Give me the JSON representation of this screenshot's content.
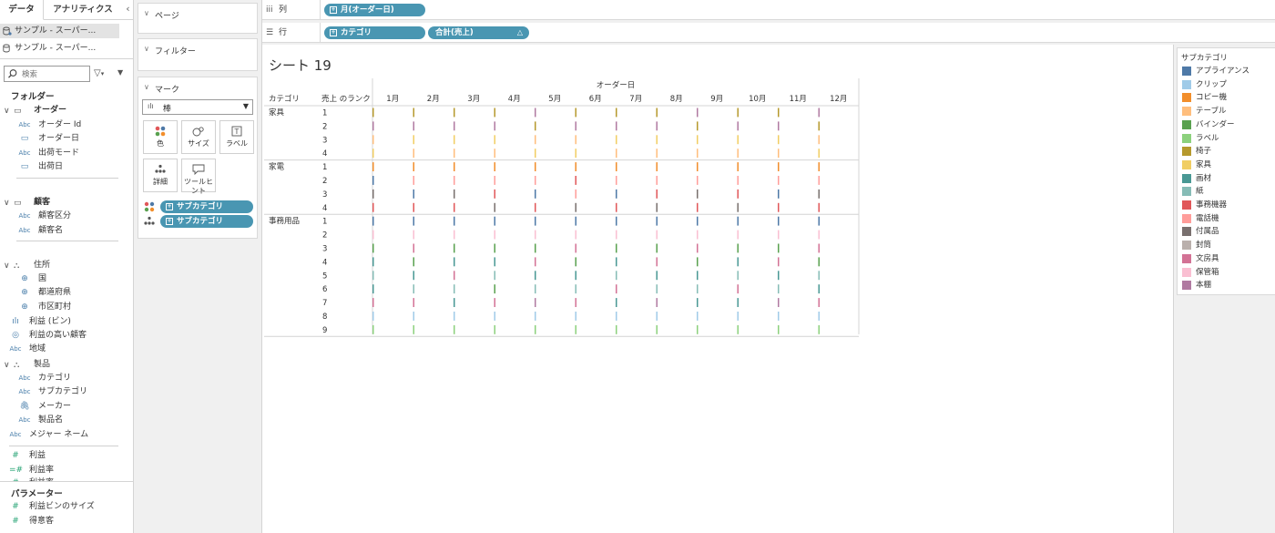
{
  "data_pane": {
    "tabs": [
      "データ",
      "アナリティクス"
    ],
    "collapse_glyph": "‹",
    "data_sources": [
      "サンプル - スーパー...",
      "サンプル - スーパー..."
    ],
    "search_placeholder": "検索",
    "folders_title": "フォルダー",
    "parameters_title": "パラメーター",
    "groups": [
      {
        "name": "オーダー",
        "bold": true,
        "fields": [
          {
            "label": "オーダー Id",
            "type": "Abc"
          },
          {
            "label": "オーダー日",
            "type": "date"
          },
          {
            "label": "出荷モード",
            "type": "Abc"
          },
          {
            "label": "出荷日",
            "type": "date"
          }
        ]
      },
      {
        "name": "顧客",
        "bold": true,
        "fields": [
          {
            "label": "顧客区分",
            "type": "Abc"
          },
          {
            "label": "顧客名",
            "type": "Abc"
          }
        ]
      },
      {
        "name": "住所",
        "bold": false,
        "fields": [
          {
            "label": "国",
            "type": "geo"
          },
          {
            "label": "都道府県",
            "type": "geo"
          },
          {
            "label": "市区町村",
            "type": "geo"
          }
        ]
      }
    ],
    "loose_fields": [
      {
        "label": "利益 (ビン)",
        "type": "bin"
      },
      {
        "label": "利益の高い顧客",
        "type": "set"
      },
      {
        "label": "地域",
        "type": "Abc"
      }
    ],
    "product_group": {
      "name": "製品",
      "fields": [
        {
          "label": "カテゴリ",
          "type": "Abc"
        },
        {
          "label": "サブカテゴリ",
          "type": "Abc"
        },
        {
          "label": "メーカー",
          "type": "clip"
        },
        {
          "label": "製品名",
          "type": "Abc"
        }
      ]
    },
    "after_product": [
      {
        "label": "メジャー ネーム",
        "type": "Abc"
      }
    ],
    "measures": [
      {
        "label": "利益",
        "type": "meas"
      },
      {
        "label": "利益率",
        "type": "meas-calc"
      },
      {
        "label": "利益率",
        "type": "meas"
      }
    ],
    "parameters": [
      {
        "label": "利益ビンのサイズ",
        "type": "meas"
      },
      {
        "label": "得意客",
        "type": "meas"
      }
    ]
  },
  "cards": {
    "pages_title": "ページ",
    "filters_title": "フィルター",
    "marks_title": "マーク",
    "mark_type": "棒",
    "mark_buttons": [
      "色",
      "サイズ",
      "ラベル",
      "詳細",
      "ツールヒント"
    ],
    "mark_pills": [
      "サブカテゴリ",
      "サブカテゴリ"
    ]
  },
  "shelves": {
    "columns_label": "列",
    "rows_label": "行",
    "column_pills": [
      "月(オーダー日)"
    ],
    "row_pills": [
      "カテゴリ",
      "合計(売上)"
    ]
  },
  "sheet": {
    "title": "シート 19"
  },
  "legend": {
    "title": "サブカテゴリ",
    "items": [
      {
        "label": "アプライアンス",
        "color": "#4e79a7"
      },
      {
        "label": "クリップ",
        "color": "#a0cbe8"
      },
      {
        "label": "コピー機",
        "color": "#f28e2b"
      },
      {
        "label": "テーブル",
        "color": "#ffbe7d"
      },
      {
        "label": "バインダー",
        "color": "#59a14f"
      },
      {
        "label": "ラベル",
        "color": "#8cd17d"
      },
      {
        "label": "椅子",
        "color": "#b6992d"
      },
      {
        "label": "家具",
        "color": "#f1ce63"
      },
      {
        "label": "画材",
        "color": "#499894"
      },
      {
        "label": "紙",
        "color": "#86bcb6"
      },
      {
        "label": "事務機器",
        "color": "#e15759"
      },
      {
        "label": "電話機",
        "color": "#ff9d9a"
      },
      {
        "label": "付属品",
        "color": "#79706e"
      },
      {
        "label": "封筒",
        "color": "#bab0ac"
      },
      {
        "label": "文房具",
        "color": "#d37295"
      },
      {
        "label": "保管箱",
        "color": "#fabfd2"
      },
      {
        "label": "本棚",
        "color": "#b07aa1"
      }
    ]
  },
  "chart_data": {
    "type": "table",
    "column_header_title": "オーダー日",
    "row_header_titles": [
      "カテゴリ",
      "売上 のランク"
    ],
    "columns": [
      "1月",
      "2月",
      "3月",
      "4月",
      "5月",
      "6月",
      "7月",
      "8月",
      "9月",
      "10月",
      "11月",
      "12月"
    ],
    "categories": [
      {
        "name": "家具",
        "ranks": [
          "1",
          "2",
          "3",
          "4"
        ],
        "rank_colors": [
          [
            "#b6992d",
            "#b6992d",
            "#b6992d",
            "#b6992d",
            "#b07aa1",
            "#b6992d",
            "#b6992d",
            "#b6992d",
            "#b07aa1",
            "#b6992d",
            "#b6992d",
            "#b07aa1"
          ],
          [
            "#b07aa1",
            "#b07aa1",
            "#b07aa1",
            "#b07aa1",
            "#b6992d",
            "#b07aa1",
            "#b07aa1",
            "#b07aa1",
            "#b6992d",
            "#b07aa1",
            "#b07aa1",
            "#b6992d"
          ],
          [
            "#ffbe7d",
            "#f1ce63",
            "#f1ce63",
            "#f1ce63",
            "#ffbe7d",
            "#ffbe7d",
            "#f1ce63",
            "#f1ce63",
            "#f1ce63",
            "#f1ce63",
            "#f1ce63",
            "#ffbe7d"
          ],
          [
            "#f1ce63",
            "#ffbe7d",
            "#ffbe7d",
            "#ffbe7d",
            "#f1ce63",
            "#f1ce63",
            "#ffbe7d",
            "#ffbe7d",
            "#ffbe7d",
            "#ffbe7d",
            "#ffbe7d",
            "#f1ce63"
          ]
        ]
      },
      {
        "name": "家電",
        "ranks": [
          "1",
          "2",
          "3",
          "4"
        ],
        "rank_colors": [
          [
            "#f28e2b",
            "#f28e2b",
            "#f28e2b",
            "#f28e2b",
            "#f28e2b",
            "#f28e2b",
            "#f28e2b",
            "#f28e2b",
            "#f28e2b",
            "#f28e2b",
            "#f28e2b",
            "#f28e2b"
          ],
          [
            "#4e79a7",
            "#ff9d9a",
            "#ff9d9a",
            "#ff9d9a",
            "#ff9d9a",
            "#e15759",
            "#ff9d9a",
            "#ff9d9a",
            "#ff9d9a",
            "#ff9d9a",
            "#ff9d9a",
            "#ff9d9a"
          ],
          [
            "#79706e",
            "#4e79a7",
            "#79706e",
            "#e15759",
            "#4e79a7",
            "#ff9d9a",
            "#4e79a7",
            "#e15759",
            "#79706e",
            "#e15759",
            "#4e79a7",
            "#79706e"
          ],
          [
            "#e15759",
            "#e15759",
            "#e15759",
            "#79706e",
            "#e15759",
            "#79706e",
            "#e15759",
            "#79706e",
            "#e15759",
            "#79706e",
            "#e15759",
            "#e15759"
          ]
        ]
      },
      {
        "name": "事務用品",
        "ranks": [
          "1",
          "2",
          "3",
          "4",
          "5",
          "6",
          "7",
          "8",
          "9"
        ],
        "rank_colors": [
          [
            "#4e79a7",
            "#4e79a7",
            "#4e79a7",
            "#4e79a7",
            "#4e79a7",
            "#4e79a7",
            "#4e79a7",
            "#4e79a7",
            "#4e79a7",
            "#4e79a7",
            "#4e79a7",
            "#4e79a7"
          ],
          [
            "#fabfd2",
            "#fabfd2",
            "#fabfd2",
            "#fabfd2",
            "#fabfd2",
            "#fabfd2",
            "#fabfd2",
            "#fabfd2",
            "#fabfd2",
            "#fabfd2",
            "#fabfd2",
            "#fabfd2"
          ],
          [
            "#59a14f",
            "#d37295",
            "#59a14f",
            "#59a14f",
            "#59a14f",
            "#d37295",
            "#59a14f",
            "#59a14f",
            "#d37295",
            "#59a14f",
            "#59a14f",
            "#d37295"
          ],
          [
            "#499894",
            "#59a14f",
            "#499894",
            "#499894",
            "#d37295",
            "#59a14f",
            "#499894",
            "#d37295",
            "#59a14f",
            "#499894",
            "#d37295",
            "#59a14f"
          ],
          [
            "#86bcb6",
            "#499894",
            "#d37295",
            "#86bcb6",
            "#499894",
            "#499894",
            "#86bcb6",
            "#499894",
            "#499894",
            "#86bcb6",
            "#499894",
            "#86bcb6"
          ],
          [
            "#499894",
            "#86bcb6",
            "#86bcb6",
            "#59a14f",
            "#86bcb6",
            "#86bcb6",
            "#d37295",
            "#86bcb6",
            "#86bcb6",
            "#d37295",
            "#86bcb6",
            "#499894"
          ],
          [
            "#d37295",
            "#d37295",
            "#499894",
            "#d37295",
            "#b07aa1",
            "#d37295",
            "#499894",
            "#b07aa1",
            "#499894",
            "#499894",
            "#b07aa1",
            "#d37295"
          ],
          [
            "#a0cbe8",
            "#a0cbe8",
            "#a0cbe8",
            "#a0cbe8",
            "#a0cbe8",
            "#a0cbe8",
            "#a0cbe8",
            "#a0cbe8",
            "#a0cbe8",
            "#a0cbe8",
            "#a0cbe8",
            "#a0cbe8"
          ],
          [
            "#8cd17d",
            "#8cd17d",
            "#8cd17d",
            "#8cd17d",
            "#8cd17d",
            "#8cd17d",
            "#8cd17d",
            "#8cd17d",
            "#8cd17d",
            "#8cd17d",
            "#8cd17d",
            "#8cd17d"
          ]
        ]
      }
    ]
  }
}
